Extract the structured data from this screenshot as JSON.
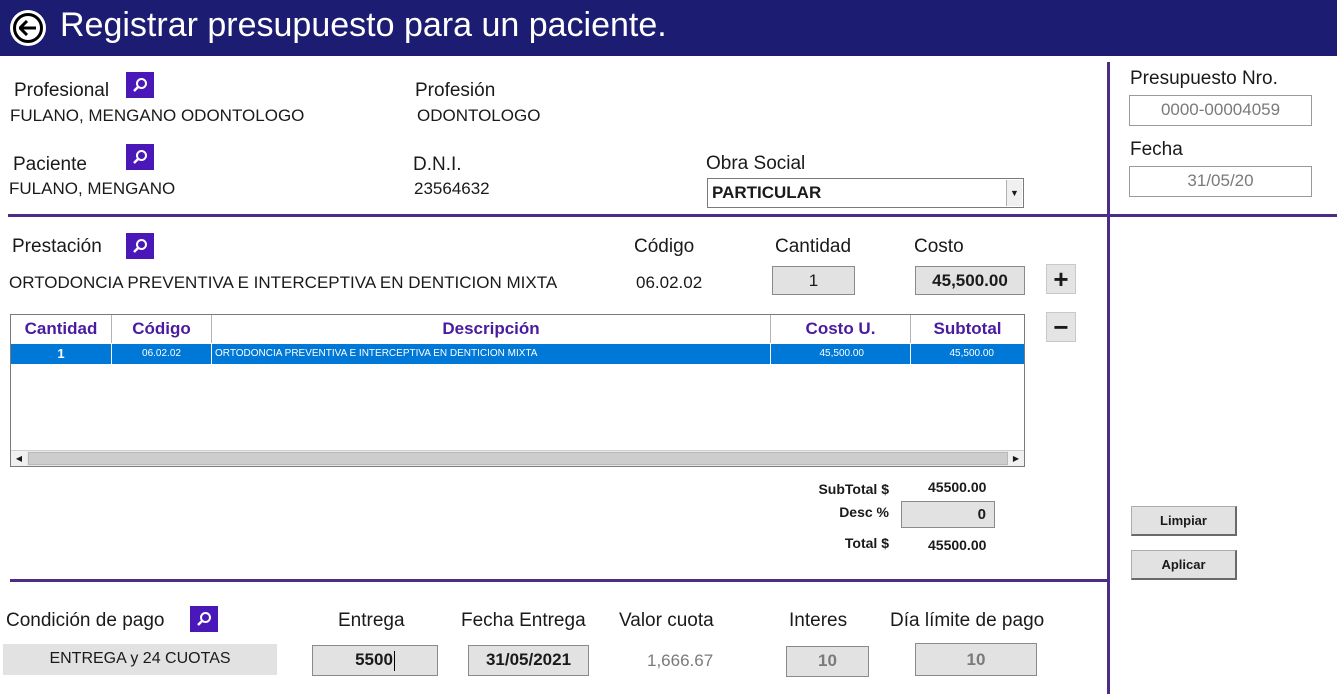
{
  "header": {
    "title": "Registrar presupuesto para un paciente."
  },
  "profesional": {
    "label": "Profesional",
    "value": "FULANO, MENGANO ODONTOLOGO"
  },
  "profesion": {
    "label": "Profesión",
    "value": "ODONTOLOGO"
  },
  "paciente": {
    "label": "Paciente",
    "value": "FULANO, MENGANO"
  },
  "dni": {
    "label": "D.N.I.",
    "value": "23564632"
  },
  "obra_social": {
    "label": "Obra Social",
    "selected": "PARTICULAR"
  },
  "presupuesto": {
    "label": "Presupuesto Nro.",
    "value": "0000-00004059"
  },
  "fecha": {
    "label": "Fecha",
    "value": "31/05/20"
  },
  "prestacion": {
    "label": "Prestación",
    "value": "ORTODONCIA PREVENTIVA E INTERCEPTIVA EN DENTICION MIXTA",
    "codigo_label": "Código",
    "codigo": "06.02.02",
    "cantidad_label": "Cantidad",
    "cantidad": "1",
    "costo_label": "Costo",
    "costo": "45,500.00"
  },
  "grid": {
    "columns": [
      "Cantidad",
      "Código",
      "Descripción",
      "Costo U.",
      "Subtotal"
    ],
    "rows": [
      {
        "cantidad": "1",
        "codigo": "06.02.02",
        "descripcion": "ORTODONCIA PREVENTIVA E INTERCEPTIVA EN DENTICION MIXTA",
        "costo": "45,500.00",
        "subtotal": "45,500.00"
      }
    ]
  },
  "totals": {
    "subtotal_label": "SubTotal $",
    "subtotal": "45500.00",
    "desc_label": "Desc %",
    "desc": "0",
    "total_label": "Total $",
    "total": "45500.00"
  },
  "actions": {
    "limpiar": "Limpiar",
    "aplicar": "Aplicar"
  },
  "pago": {
    "condicion_label": "Condición de pago",
    "condicion": "ENTREGA y 24 CUOTAS",
    "entrega_label": "Entrega",
    "entrega": "5500",
    "fecha_entrega_label": "Fecha Entrega",
    "fecha_entrega": "31/05/2021",
    "valor_cuota_label": "Valor cuota",
    "valor_cuota": "1,666.67",
    "interes_label": "Interes",
    "interes": "10",
    "dia_limite_label": "Día límite de pago",
    "dia_limite": "10"
  },
  "colors": {
    "title_bar": "#1c1c72",
    "accent": "#4a18b8",
    "selection": "#0078d7",
    "divider": "#4b2c86"
  }
}
